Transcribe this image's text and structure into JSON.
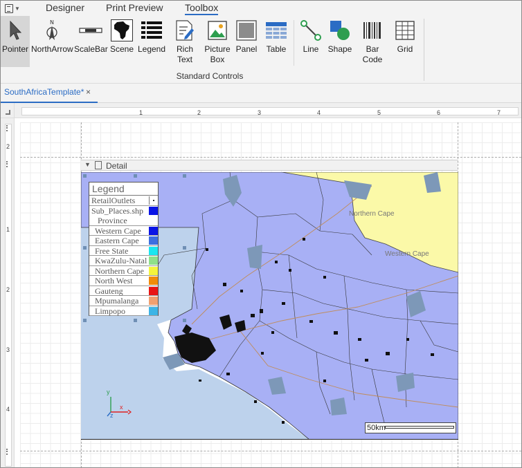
{
  "ribbon": {
    "tabs": [
      {
        "label": "Designer"
      },
      {
        "label": "Print Preview"
      },
      {
        "label": "Toolbox",
        "active": true
      }
    ],
    "tools": [
      {
        "label": "Pointer",
        "icon": "pointer-icon",
        "selected": true
      },
      {
        "label": "NorthArrow",
        "icon": "north-arrow-icon"
      },
      {
        "label": "ScaleBar",
        "icon": "scale-bar-icon"
      },
      {
        "label": "Scene",
        "icon": "africa-map-icon"
      },
      {
        "label": "Legend",
        "icon": "legend-list-icon"
      },
      {
        "label": "Rich Text",
        "icon": "rich-text-icon"
      },
      {
        "label": "Picture",
        "label2": "Box",
        "icon": "picture-icon"
      },
      {
        "label": "Panel",
        "icon": "panel-icon"
      },
      {
        "label": "Table",
        "icon": "table-icon"
      },
      {
        "label": "Line",
        "icon": "line-icon"
      },
      {
        "label": "Shape",
        "icon": "shape-icon"
      },
      {
        "label": "Bar Code",
        "icon": "barcode-icon"
      },
      {
        "label": "Grid",
        "icon": "grid-icon"
      }
    ],
    "group_label": "Standard Controls"
  },
  "document_tab": {
    "label": "SouthAfricaTemplate*",
    "close": "×"
  },
  "rulers": {
    "horizontal": [
      "1",
      "2",
      "3",
      "4",
      "5",
      "6",
      "7"
    ],
    "vertical": [
      "2",
      "1",
      "2",
      "3",
      "4"
    ]
  },
  "band": {
    "label": "Detail"
  },
  "legend": {
    "title": "Legend",
    "layer1": "RetailOutlets",
    "layer2": "Sub_Places.shp",
    "layer2_field": "Province",
    "items": [
      {
        "label": "Western Cape",
        "color": "#0a14e6"
      },
      {
        "label": "Eastern Cape",
        "color": "#3d6fe0"
      },
      {
        "label": "Free State",
        "color": "#19e6f0"
      },
      {
        "label": "KwaZulu-Natal",
        "color": "#8fe08a"
      },
      {
        "label": "Northern Cape",
        "color": "#f4f43c"
      },
      {
        "label": "North West",
        "color": "#f08c0a"
      },
      {
        "label": "Gauteng",
        "color": "#e81414"
      },
      {
        "label": "Mpumalanga",
        "color": "#f0a070"
      },
      {
        "label": "Limpopo",
        "color": "#3cb4e6"
      }
    ]
  },
  "map": {
    "labels": {
      "northern_cape": "Northern Cape",
      "western_cape": "Western Cape"
    },
    "scalebar_text": "50km",
    "colors": {
      "western_cape": "#a8b0f5",
      "northern_cape": "#fbf9a8",
      "ocean": "#bdd2ec",
      "dam": "#7d98b8"
    }
  },
  "gizmo": {
    "y": "y",
    "x": "x",
    "z": "z"
  }
}
